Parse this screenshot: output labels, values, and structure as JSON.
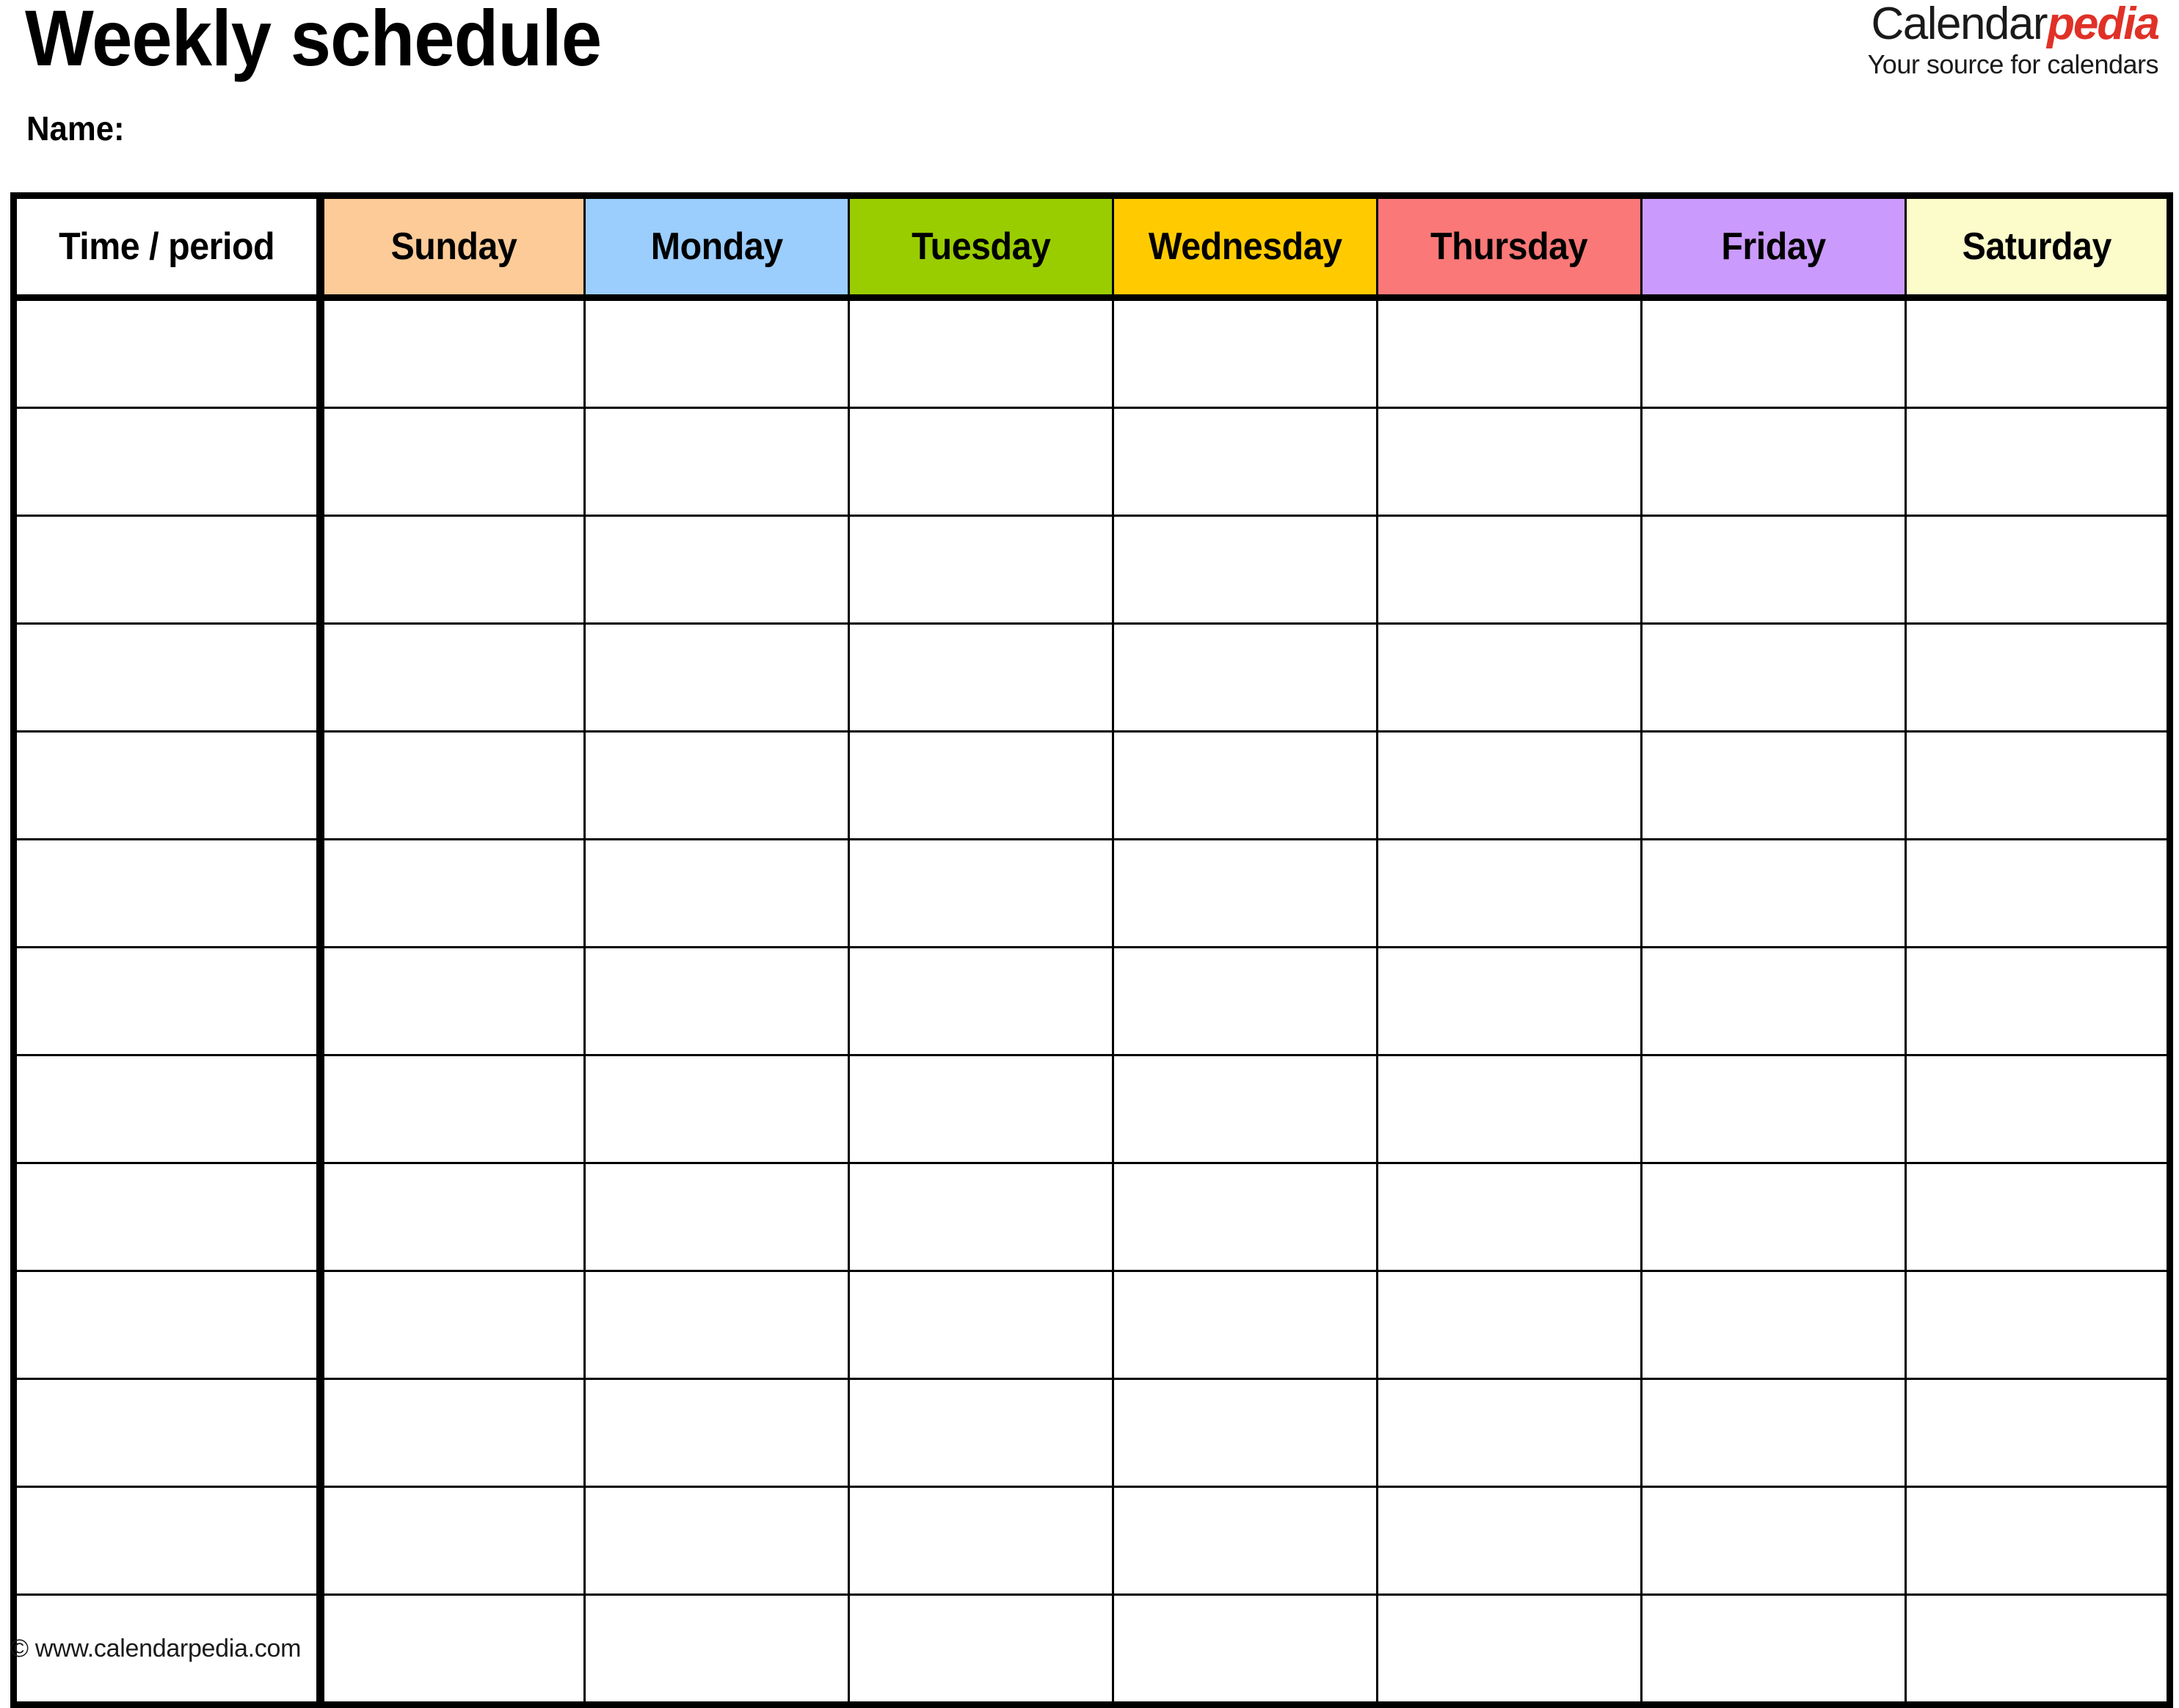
{
  "document": {
    "title": "Weekly schedule",
    "name_label": "Name:",
    "footer_copyright": "© www.calendarpedia.com"
  },
  "brand": {
    "name_part1": "Calendar",
    "name_part2": "pedia",
    "tagline": "Your source for calendars",
    "accent_color": "#e03127",
    "text_color": "#1a1a1a"
  },
  "table": {
    "time_column_header": "Time / period",
    "day_headers": [
      {
        "label": "Sunday",
        "color": "#fccb98"
      },
      {
        "label": "Monday",
        "color": "#9bcdfd"
      },
      {
        "label": "Tuesday",
        "color": "#9acd00"
      },
      {
        "label": "Wednesday",
        "color": "#ffcb00"
      },
      {
        "label": "Thursday",
        "color": "#fb7878"
      },
      {
        "label": "Friday",
        "color": "#cb9afd"
      },
      {
        "label": "Saturday",
        "color": "#fcfccb"
      }
    ],
    "row_count": 13,
    "rows": [
      {
        "time": "",
        "cells": [
          "",
          "",
          "",
          "",
          "",
          "",
          ""
        ]
      },
      {
        "time": "",
        "cells": [
          "",
          "",
          "",
          "",
          "",
          "",
          ""
        ]
      },
      {
        "time": "",
        "cells": [
          "",
          "",
          "",
          "",
          "",
          "",
          ""
        ]
      },
      {
        "time": "",
        "cells": [
          "",
          "",
          "",
          "",
          "",
          "",
          ""
        ]
      },
      {
        "time": "",
        "cells": [
          "",
          "",
          "",
          "",
          "",
          "",
          ""
        ]
      },
      {
        "time": "",
        "cells": [
          "",
          "",
          "",
          "",
          "",
          "",
          ""
        ]
      },
      {
        "time": "",
        "cells": [
          "",
          "",
          "",
          "",
          "",
          "",
          ""
        ]
      },
      {
        "time": "",
        "cells": [
          "",
          "",
          "",
          "",
          "",
          "",
          ""
        ]
      },
      {
        "time": "",
        "cells": [
          "",
          "",
          "",
          "",
          "",
          "",
          ""
        ]
      },
      {
        "time": "",
        "cells": [
          "",
          "",
          "",
          "",
          "",
          "",
          ""
        ]
      },
      {
        "time": "",
        "cells": [
          "",
          "",
          "",
          "",
          "",
          "",
          ""
        ]
      },
      {
        "time": "",
        "cells": [
          "",
          "",
          "",
          "",
          "",
          "",
          ""
        ]
      },
      {
        "time": "",
        "cells": [
          "",
          "",
          "",
          "",
          "",
          "",
          ""
        ]
      }
    ]
  }
}
